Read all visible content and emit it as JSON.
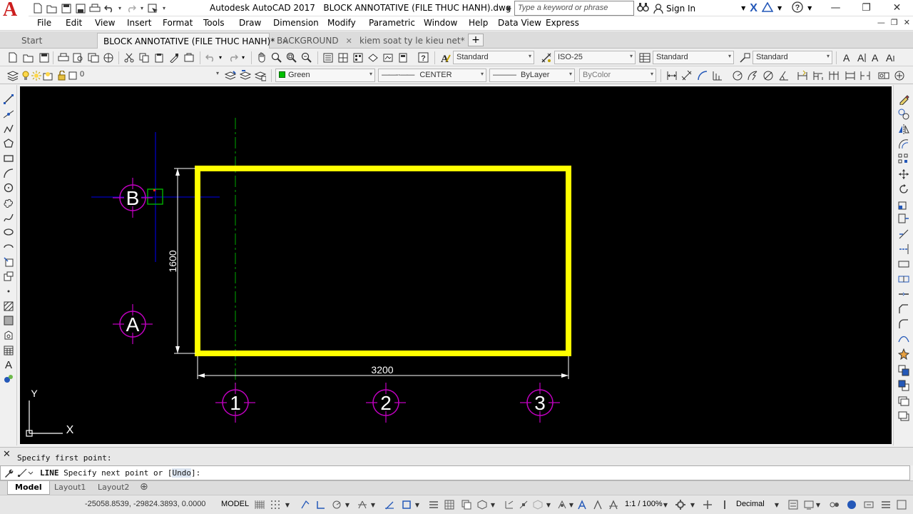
{
  "window": {
    "app_name": "Autodesk AutoCAD 2017",
    "file_name": "BLOCK ANNOTATIVE (FILE THUC HANH).dwg",
    "logo_letter": "A"
  },
  "search": {
    "placeholder": "Type a keyword or phrase"
  },
  "account": {
    "sign_in": "Sign In"
  },
  "menu": [
    "File",
    "Edit",
    "View",
    "Insert",
    "Format",
    "Tools",
    "Draw",
    "Dimension",
    "Modify",
    "Parametric",
    "Window",
    "Help",
    "Data View",
    "Express"
  ],
  "file_tabs": [
    {
      "label": "Start",
      "active": false,
      "closable": false
    },
    {
      "label": "BLOCK ANNOTATIVE (FILE THUC HANH)*",
      "active": true,
      "closable": true
    },
    {
      "label": "BACKGROUND",
      "active": false,
      "closable": true
    },
    {
      "label": "kiem soat ty le kieu net*",
      "active": false,
      "closable": true
    }
  ],
  "styles": {
    "text_style": "Standard",
    "dim_style": "ISO-25",
    "table_style": "Standard",
    "mleader_style": "Standard"
  },
  "layers": {
    "current_layer": "0",
    "color": "Green",
    "linetype": "CENTER",
    "lineweight": "ByLayer",
    "plot_style": "ByColor"
  },
  "drawing": {
    "background": "#000000",
    "rect_color": "#ffff00",
    "grid_color": "#c000c0",
    "dim_color": "#ffffff",
    "axis_line_color": "#008000",
    "crosshair_color": "#0000c0",
    "dimension_width": "3200",
    "dimension_height": "1600",
    "grid_bubbles_x": [
      "1",
      "2",
      "3"
    ],
    "grid_bubbles_y": [
      "B",
      "A"
    ],
    "ucs_x": "X",
    "ucs_y": "Y"
  },
  "command": {
    "history": "Specify first point:",
    "name": "LINE",
    "prompt_before": " Specify next point or [",
    "option": "Undo",
    "prompt_after": "]:"
  },
  "layout_tabs": [
    {
      "label": "Model",
      "active": true
    },
    {
      "label": "Layout1",
      "active": false
    },
    {
      "label": "Layout2",
      "active": false
    }
  ],
  "status": {
    "coordinates": "-25058.8539, -29824.3893, 0.0000",
    "space": "MODEL",
    "annotation_scale": "1:1 / 100%",
    "units": "Decimal"
  }
}
